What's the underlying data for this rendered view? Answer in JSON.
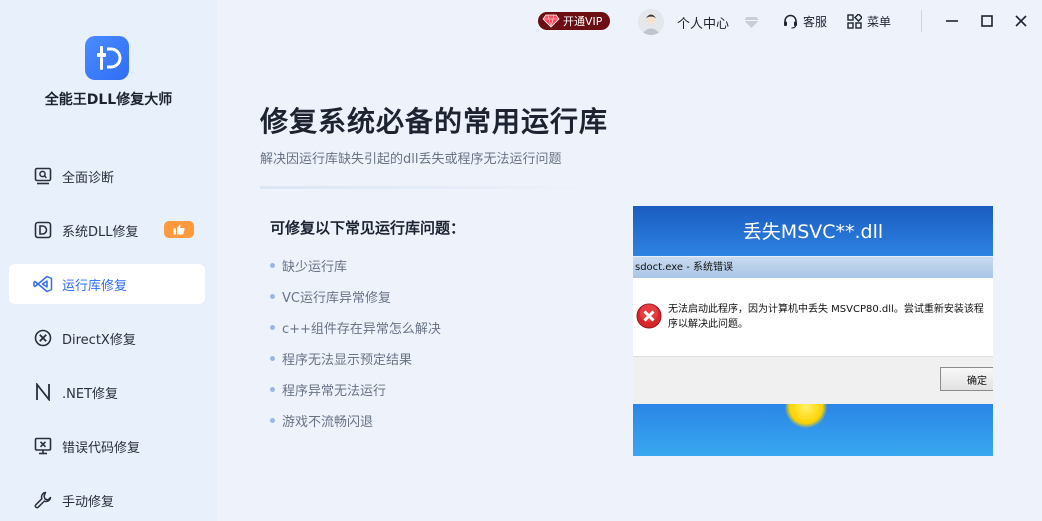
{
  "app": {
    "title": "全能王DLL修复大师"
  },
  "sidebar": {
    "items": [
      {
        "label": "全面诊断",
        "icon": "diagnosis-icon"
      },
      {
        "label": "系统DLL修复",
        "icon": "dll-icon",
        "badge_icon": "thumbs-up-icon"
      },
      {
        "label": "运行库修复",
        "icon": "runtime-icon",
        "active": true
      },
      {
        "label": "DirectX修复",
        "icon": "directx-icon"
      },
      {
        "label": ".NET修复",
        "icon": "dotnet-icon"
      },
      {
        "label": "错误代码修复",
        "icon": "error-code-icon"
      },
      {
        "label": "手动修复",
        "icon": "wrench-icon"
      }
    ]
  },
  "topbar": {
    "vip_label": "开通VIP",
    "user_center": "个人中心",
    "service": "客服",
    "menu": "菜单"
  },
  "main": {
    "title": "修复系统必备的常用运行库",
    "subtitle": "解决因运行库缺失引起的dll丢失或程序无法运行问题",
    "list_title": "可修复以下常见运行库问题：",
    "issues": [
      "缺少运行库",
      "VC运行库异常修复",
      "c++组件存在异常怎么解决",
      "程序无法显示预定结果",
      "程序异常无法运行",
      "游戏不流畅闪退"
    ]
  },
  "error_image": {
    "heading": "丢失MSVC**.dll",
    "window_title": "sdoct.exe - 系统错误",
    "message": "无法启动此程序，因为计算机中丢失 MSVCP80.dll。尝试重新安装该程序以解决此问题。",
    "ok_button": "确定"
  },
  "colors": {
    "accent": "#2f6ef5",
    "sidebar_bg": "#e8f0fb",
    "vip_bg": "#6b0f12",
    "badge": "#ff9a3c"
  }
}
